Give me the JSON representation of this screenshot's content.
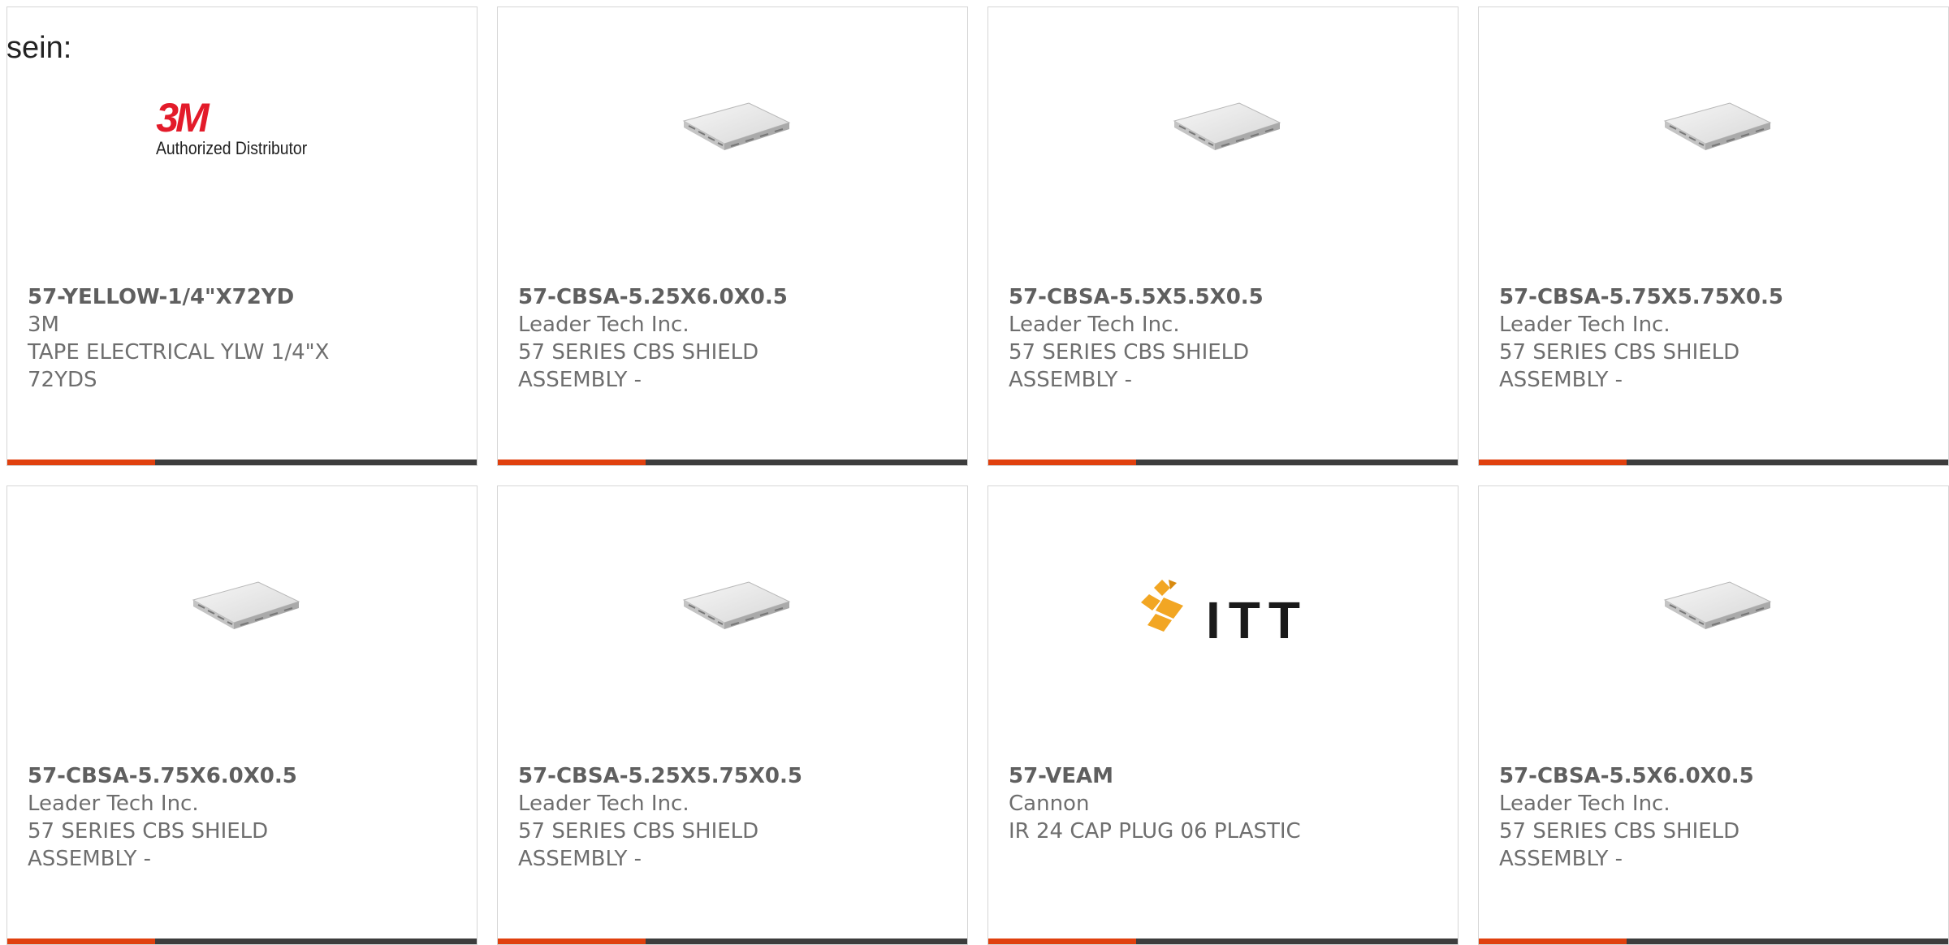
{
  "page": {
    "heading": "sein:"
  },
  "colors": {
    "accent": "#e0400e",
    "bar": "#3d3d3d",
    "logo_3m_red": "#e31b2a",
    "logo_itt_gold": "#f2a623"
  },
  "products": [
    {
      "part_number": "57-YELLOW-1/4\"X72YD",
      "manufacturer": "3M",
      "description": "TAPE ELECTRICAL YLW 1/4\"X 72YDS",
      "image": "3m-logo",
      "logo": {
        "mark": "3M",
        "tagline": "Authorized Distributor"
      }
    },
    {
      "part_number": "57-CBSA-5.25X6.0X0.5",
      "manufacturer": "Leader Tech Inc.",
      "description": "57 SERIES CBS SHIELD ASSEMBLY -",
      "image": "shield-product-photo"
    },
    {
      "part_number": "57-CBSA-5.5X5.5X0.5",
      "manufacturer": "Leader Tech Inc.",
      "description": "57 SERIES CBS SHIELD ASSEMBLY -",
      "image": "shield-product-photo"
    },
    {
      "part_number": "57-CBSA-5.75X5.75X0.5",
      "manufacturer": "Leader Tech Inc.",
      "description": "57 SERIES CBS SHIELD ASSEMBLY -",
      "image": "shield-product-photo"
    },
    {
      "part_number": "57-CBSA-5.75X6.0X0.5",
      "manufacturer": "Leader Tech Inc.",
      "description": "57 SERIES CBS SHIELD ASSEMBLY -",
      "image": "shield-product-photo"
    },
    {
      "part_number": "57-CBSA-5.25X5.75X0.5",
      "manufacturer": "Leader Tech Inc.",
      "description": "57 SERIES CBS SHIELD ASSEMBLY -",
      "image": "shield-product-photo"
    },
    {
      "part_number": "57-VEAM",
      "manufacturer": "Cannon",
      "description": "IR 24 CAP PLUG 06 PLASTIC",
      "image": "itt-logo",
      "logo": {
        "mark": "ITT"
      }
    },
    {
      "part_number": "57-CBSA-5.5X6.0X0.5",
      "manufacturer": "Leader Tech Inc.",
      "description": "57 SERIES CBS SHIELD ASSEMBLY -",
      "image": "shield-product-photo"
    }
  ]
}
